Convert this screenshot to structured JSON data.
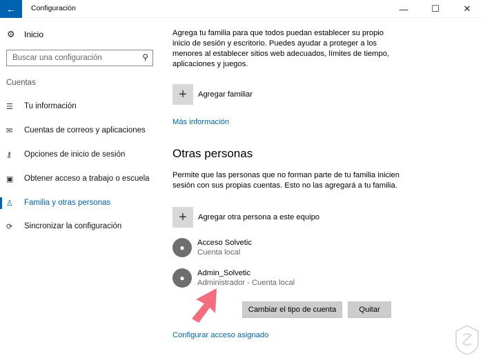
{
  "window": {
    "title": "Configuración",
    "back_glyph": "←",
    "min_glyph": "—",
    "max_glyph": "☐",
    "close_glyph": "✕"
  },
  "sidebar": {
    "home_label": "Inicio",
    "search_placeholder": "Buscar una configuración",
    "section_label": "Cuentas",
    "items": [
      {
        "label": "Tu información",
        "icon": "person-card-icon",
        "glyph": "☰"
      },
      {
        "label": "Cuentas de correos y aplicaciones",
        "icon": "mail-icon",
        "glyph": "✉"
      },
      {
        "label": "Opciones de inicio de sesión",
        "icon": "key-icon",
        "glyph": "⚷"
      },
      {
        "label": "Obtener acceso a trabajo o escuela",
        "icon": "briefcase-icon",
        "glyph": "▣"
      },
      {
        "label": "Familia y otras personas",
        "icon": "people-icon",
        "glyph": "♙",
        "active": true
      },
      {
        "label": "Sincronizar la configuración",
        "icon": "sync-icon",
        "glyph": "⟳"
      }
    ]
  },
  "main": {
    "family_description": "Agrega tu familia para que todos puedan establecer su propio inicio de sesión y escritorio. Puedes ayudar a proteger a los menores al establecer sitios web adecuados, límites de tiempo, aplicaciones y juegos.",
    "add_family_label": "Agregar familiar",
    "more_info_link": "Más información",
    "others_heading": "Otras personas",
    "others_description": "Permite que las personas que no forman parte de tu familia inicien sesión con sus propias cuentas. Esto no las agregará a tu familia.",
    "add_other_label": "Agregar otra persona a este equipo",
    "people": [
      {
        "name": "Acceso Solvetic",
        "type": "Cuenta local"
      },
      {
        "name": "Admin_Solvetic",
        "type": "Administrador - Cuenta local"
      }
    ],
    "change_type_button": "Cambiar el tipo de cuenta",
    "remove_button": "Quitar",
    "assigned_access_link": "Configurar acceso asignado"
  },
  "colors": {
    "accent": "#0063b1",
    "annotation_arrow": "#f26d7d"
  }
}
